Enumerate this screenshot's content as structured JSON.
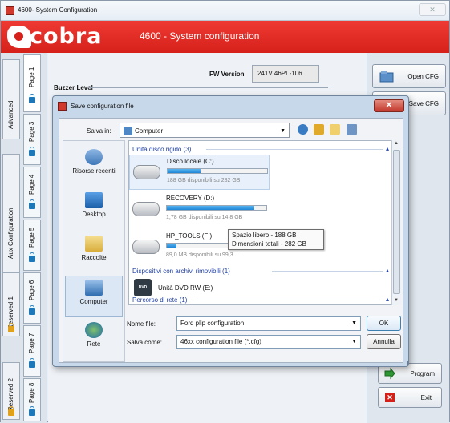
{
  "window": {
    "title": "4600- System Configuration",
    "close_label": "✕"
  },
  "brand": {
    "logo_text": "cobra",
    "title": "4600 - System configuration",
    "color": "#e0291f"
  },
  "main": {
    "fw_label": "FW Version",
    "fw_value": "241V 46PL-106",
    "buzzer_label": "Buzzer Level"
  },
  "left_tabs": {
    "groups": [
      {
        "label": "Advanced",
        "pages": [
          "Page 1"
        ]
      },
      {
        "label": "Aux Configuration",
        "pages": [
          "Page 3",
          "Page 4",
          "Page 5"
        ]
      },
      {
        "label": "Reserved 1",
        "pages": [
          "Page 6",
          "Page 7"
        ]
      },
      {
        "label": "Reserved 2",
        "pages": [
          "Page 8"
        ]
      }
    ]
  },
  "right_panel": {
    "open_cfg": "Open CFG",
    "save_cfg": "Save CFG",
    "program": "Program",
    "exit": "Exit"
  },
  "dialog": {
    "title": "Save configuration file",
    "close_label": "✕",
    "save_in_label": "Salva in:",
    "save_in_value": "Computer",
    "places": [
      {
        "label": "Risorse recenti",
        "icon": "recent-icon"
      },
      {
        "label": "Desktop",
        "icon": "desktop-icon"
      },
      {
        "label": "Raccolte",
        "icon": "libraries-icon"
      },
      {
        "label": "Computer",
        "icon": "computer-icon"
      },
      {
        "label": "Rete",
        "icon": "network-icon"
      }
    ],
    "groups": {
      "hard_disks": "Unità disco rigido (3)",
      "removable": "Dispositivi con archivi rimovibili (1)",
      "network": "Percorso di rete (1)"
    },
    "drives": [
      {
        "name": "Disco locale (C:)",
        "info": "188 GB disponibili su 282 GB",
        "used_fraction": 0.33
      },
      {
        "name": "RECOVERY (D:)",
        "info": "1,78 GB disponibili su 14,8 GB",
        "used_fraction": 0.88
      },
      {
        "name": "HP_TOOLS (F:)",
        "info": "89,0 MB disponibili su 99,3 ...",
        "used_fraction": 0.1
      }
    ],
    "dvd": {
      "name": "Unità DVD RW (E:)",
      "badge": "DVD"
    },
    "tooltip": {
      "line1": "Spazio libero - 188 GB",
      "line2": "Dimensioni totali - 282 GB"
    },
    "file_name_label": "Nome file:",
    "file_name_value": "Ford plip configuration",
    "save_as_label": "Salva come:",
    "save_as_value": "46xx configuration file (*.cfg)",
    "ok": "OK",
    "cancel": "Annulla"
  }
}
